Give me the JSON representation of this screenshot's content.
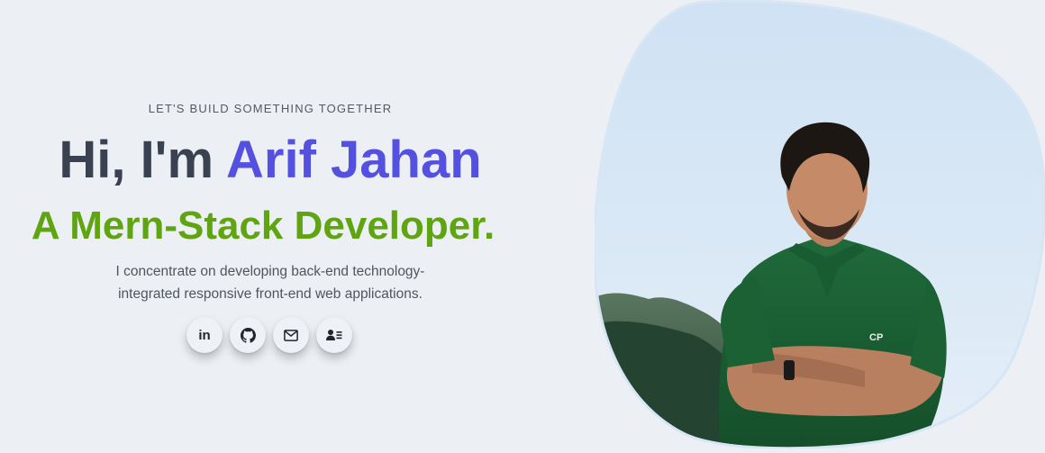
{
  "hero": {
    "eyebrow": "LET'S BUILD SOMETHING TOGETHER",
    "greeting": "Hi, I'm ",
    "name": "Arif Jahan",
    "role": "A Mern-Stack Developer.",
    "description": "I concentrate on developing back-end technology-integrated responsive front-end web applications."
  },
  "socials": [
    {
      "icon": "linkedin-icon",
      "label": "in"
    },
    {
      "icon": "github-icon"
    },
    {
      "icon": "mail-icon"
    },
    {
      "icon": "contact-card-icon"
    }
  ],
  "colors": {
    "background": "#eceff3",
    "name_accent": "#5450e0",
    "role_accent": "#5fa511",
    "heading": "#3a4150"
  }
}
